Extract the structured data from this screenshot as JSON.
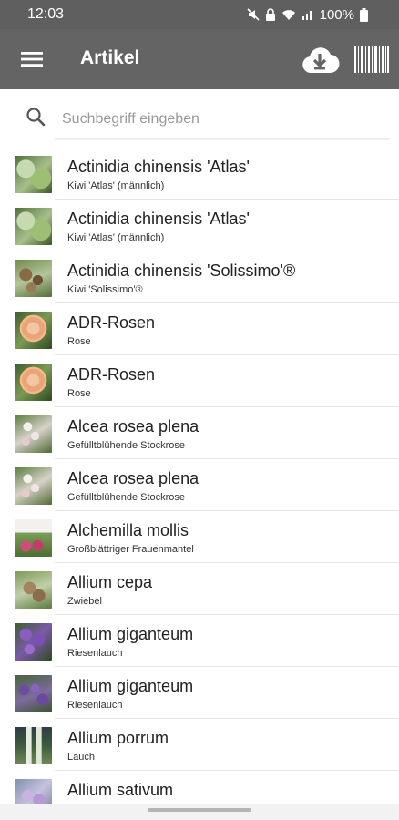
{
  "status_bar": {
    "time": "12:03",
    "battery_text": "100%",
    "icons": [
      "mute-icon",
      "lock-icon",
      "wifi-icon",
      "signal-icon",
      "battery-icon"
    ]
  },
  "app_bar": {
    "title": "Artikel",
    "icons": [
      "menu-icon",
      "cloud-download-icon",
      "barcode-icon"
    ],
    "background": "#646464"
  },
  "search": {
    "placeholder": "Suchbegriff eingeben",
    "value": ""
  },
  "items": [
    {
      "title": "Actinidia chinensis 'Atlas'",
      "subtitle": "Kiwi 'Atlas' (männlich)",
      "thumb": "t-kiwi"
    },
    {
      "title": "Actinidia chinensis 'Atlas'",
      "subtitle": "Kiwi 'Atlas' (männlich)",
      "thumb": "t-kiwi"
    },
    {
      "title": "Actinidia chinensis 'Solissimo'®",
      "subtitle": "Kiwi 'Solissimo'®",
      "thumb": "t-solissimo"
    },
    {
      "title": "ADR-Rosen",
      "subtitle": "Rose",
      "thumb": "t-rose"
    },
    {
      "title": "ADR-Rosen",
      "subtitle": "Rose",
      "thumb": "t-rose"
    },
    {
      "title": "Alcea rosea plena",
      "subtitle": "Gefülltblühende Stockrose",
      "thumb": "t-alcea"
    },
    {
      "title": "Alcea rosea plena",
      "subtitle": "Gefülltblühende Stockrose",
      "thumb": "t-alcea"
    },
    {
      "title": "Alchemilla mollis",
      "subtitle": "Großblättriger Frauenmantel",
      "thumb": "t-alchemilla"
    },
    {
      "title": "Allium cepa",
      "subtitle": "Zwiebel",
      "thumb": "t-cepa"
    },
    {
      "title": "Allium giganteum",
      "subtitle": "Riesenlauch",
      "thumb": "t-giganteum"
    },
    {
      "title": "Allium giganteum",
      "subtitle": "Riesenlauch",
      "thumb": "t-giganteum2"
    },
    {
      "title": "Allium porrum",
      "subtitle": "Lauch",
      "thumb": "t-porrum"
    },
    {
      "title": "Allium sativum",
      "subtitle": "",
      "thumb": "t-sativum"
    }
  ]
}
